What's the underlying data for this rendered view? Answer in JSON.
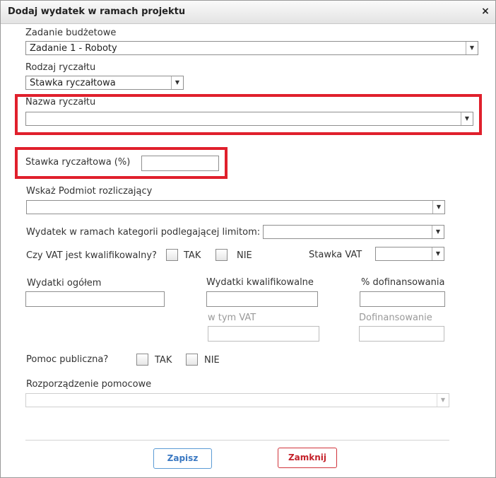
{
  "dialog": {
    "title": "Dodaj wydatek w ramach projektu",
    "close_glyph": "×"
  },
  "zadanie": {
    "label": "Zadanie budżetowe",
    "value": "Zadanie 1 - Roboty"
  },
  "rodzaj": {
    "label": "Rodzaj ryczałtu",
    "value": "Stawka ryczałtowa"
  },
  "nazwa": {
    "label": "Nazwa ryczałtu",
    "value": ""
  },
  "stawka_ryczaltowa": {
    "label": "Stawka ryczałtowa (%)",
    "value": ""
  },
  "podmiot": {
    "label": "Wskaż Podmiot rozliczający",
    "value": ""
  },
  "kategoria": {
    "label": "Wydatek w ramach kategorii podlegającej limitom:",
    "value": ""
  },
  "vat": {
    "question": "Czy VAT jest kwalifikowalny?",
    "yes": "TAK",
    "no": "NIE",
    "rate_label": "Stawka VAT",
    "rate_value": ""
  },
  "amounts": {
    "ogolem_label": "Wydatki ogółem",
    "kwalifikowalne_label": "Wydatki kwalifikowalne",
    "procent_label": "% dofinansowania",
    "w_tym_vat_label": "w tym VAT",
    "dofinansowanie_label": "Dofinansowanie"
  },
  "pomoc": {
    "question": "Pomoc publiczna?",
    "yes": "TAK",
    "no": "NIE"
  },
  "rozporzadzenie": {
    "label": "Rozporządzenie pomocowe",
    "value": ""
  },
  "buttons": {
    "save": "Zapisz",
    "close": "Zamknij"
  },
  "colors": {
    "highlight": "#e0202c",
    "save_accent": "#3a78c2",
    "close_accent": "#c4212a"
  }
}
